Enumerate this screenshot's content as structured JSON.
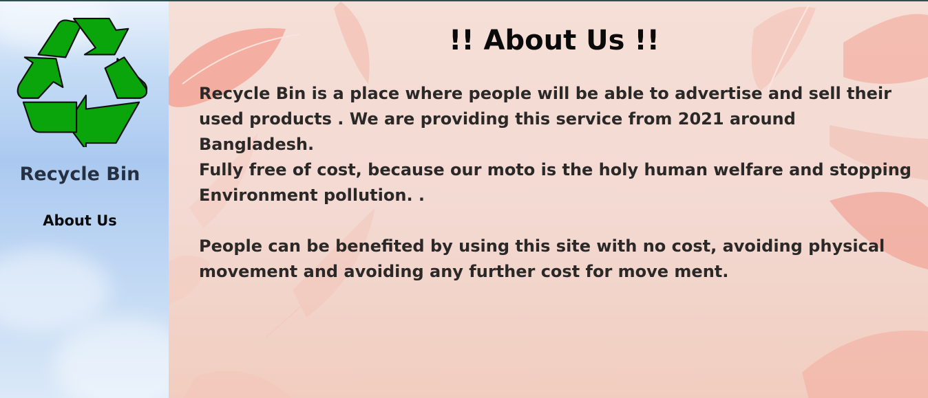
{
  "sidebar": {
    "brand": "Recycle Bin",
    "nav": {
      "about_label": "About Us"
    },
    "logo_icon": "recycle-icon",
    "logo_color": "#0aa50a"
  },
  "main": {
    "title": "!! About Us !!",
    "paragraphs": [
      "Recycle Bin is a place where people will be able to advertise and sell their used products . We are providing this service from 2021 around Bangladesh.",
      "Fully free of cost, because our moto is the holy human welfare and stopping Environment pollution. .",
      "People can be benefited by using this site with no cost, avoiding physical movement and avoiding any further cost for move ment."
    ]
  },
  "colors": {
    "sidebar_bg": "#b6d0f2",
    "main_bg": "#f4ddd6",
    "text": "#2b2828",
    "feather": "#f28d7d"
  }
}
